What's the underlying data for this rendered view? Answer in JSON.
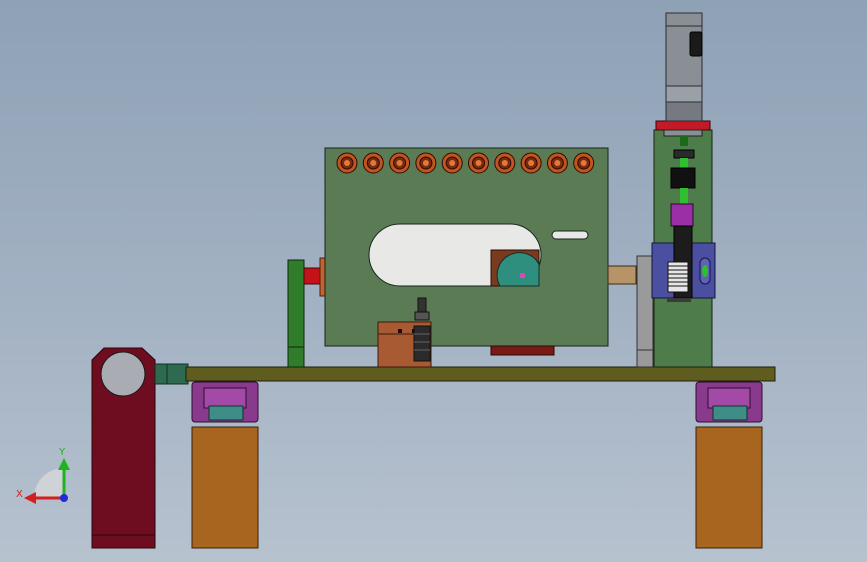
{
  "viewport": {
    "type": "cad-3d-model-view",
    "background_gradient": [
      "#8ea1b6",
      "#b7c2cf"
    ]
  },
  "triad": {
    "x_label": "X",
    "y_label": "Y",
    "x_color": "#d21f1f",
    "y_color": "#1fb31f",
    "z_color": "#1f2bd6"
  },
  "parts": [
    {
      "name": "main-fixture-plate",
      "color": "#5b7b55"
    },
    {
      "name": "base-rail",
      "color": "#5f5c1f"
    },
    {
      "name": "left-end-block",
      "color": "#6e0d20"
    },
    {
      "name": "support-legs",
      "color": "#a8651f"
    },
    {
      "name": "linear-guide-carriages",
      "color": "#8a3a8c"
    },
    {
      "name": "right-drive-tower",
      "color": "#4f7c4b"
    },
    {
      "name": "servo-motor",
      "color": "#8a8e95"
    },
    {
      "name": "gear-housing",
      "color": "#4b4fa0"
    },
    {
      "name": "left-pulley-plate",
      "color": "#2f7d2a"
    },
    {
      "name": "shaft-coupling-left",
      "color": "#c5121a"
    },
    {
      "name": "shaft-coupling-right",
      "color": "#b79468"
    },
    {
      "name": "clamp-block",
      "color": "#a85a33"
    }
  ]
}
